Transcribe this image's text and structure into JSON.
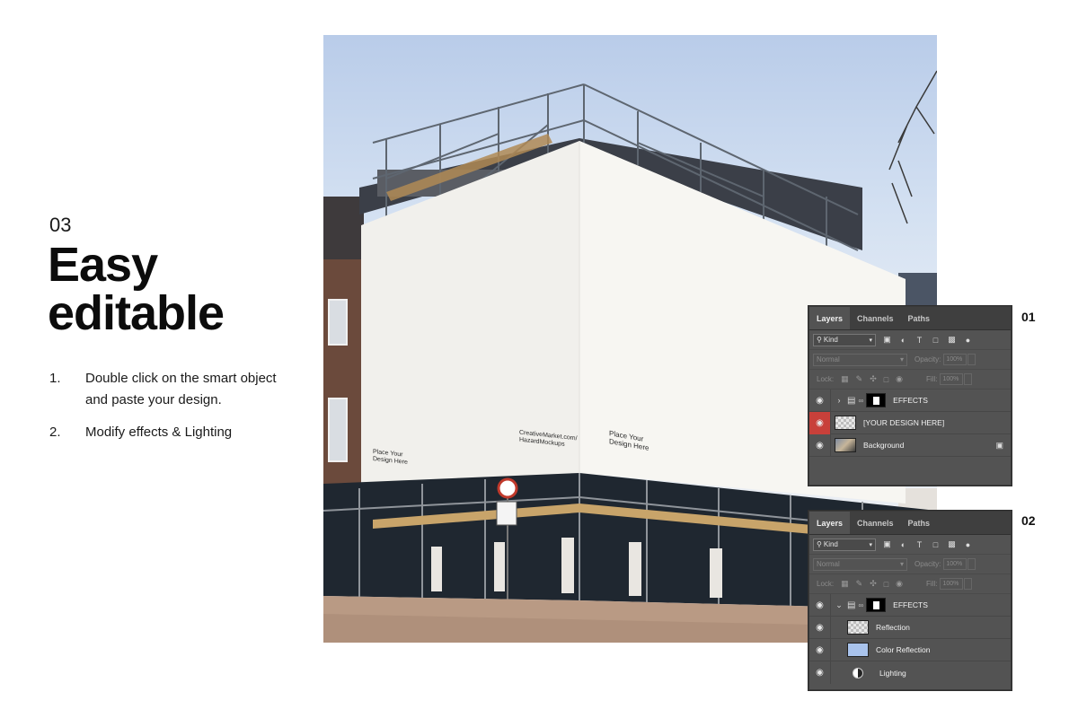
{
  "step_number": "03",
  "headline": {
    "line1": "Easy",
    "line2": "editable"
  },
  "instructions": [
    {
      "num": "1.",
      "text": "Double click on the smart object and paste your design."
    },
    {
      "num": "2.",
      "text": "Modify effects & Lighting"
    }
  ],
  "mockup_text": {
    "left": [
      "Place Your",
      "Design Here"
    ],
    "middle": [
      "CreativeMarket.com/",
      "HazardMockups"
    ],
    "right": [
      "Place Your",
      "Design Here"
    ]
  },
  "panels": [
    {
      "badge": "01",
      "tabs": [
        "Layers",
        "Channels",
        "Paths"
      ],
      "filter_kind": "Kind",
      "blend_mode": "Normal",
      "opacity_label": "Opacity:",
      "opacity_value": "100%",
      "lock_label": "Lock:",
      "fill_label": "Fill:",
      "fill_value": "100%",
      "layers": [
        "EFFECTS",
        "[YOUR DESIGN HERE]",
        "Background"
      ]
    },
    {
      "badge": "02",
      "tabs": [
        "Layers",
        "Channels",
        "Paths"
      ],
      "filter_kind": "Kind",
      "blend_mode": "Normal",
      "opacity_label": "Opacity:",
      "opacity_value": "100%",
      "lock_label": "Lock:",
      "fill_label": "Fill:",
      "fill_value": "100%",
      "layers": [
        "EFFECTS",
        "Reflection",
        "Color Reflection",
        "Lighting"
      ]
    }
  ],
  "colors": {
    "panel_bg": "#535353",
    "visibility_highlight": "#c8403a",
    "color_reflection_thumb": "#a9c3ec"
  }
}
